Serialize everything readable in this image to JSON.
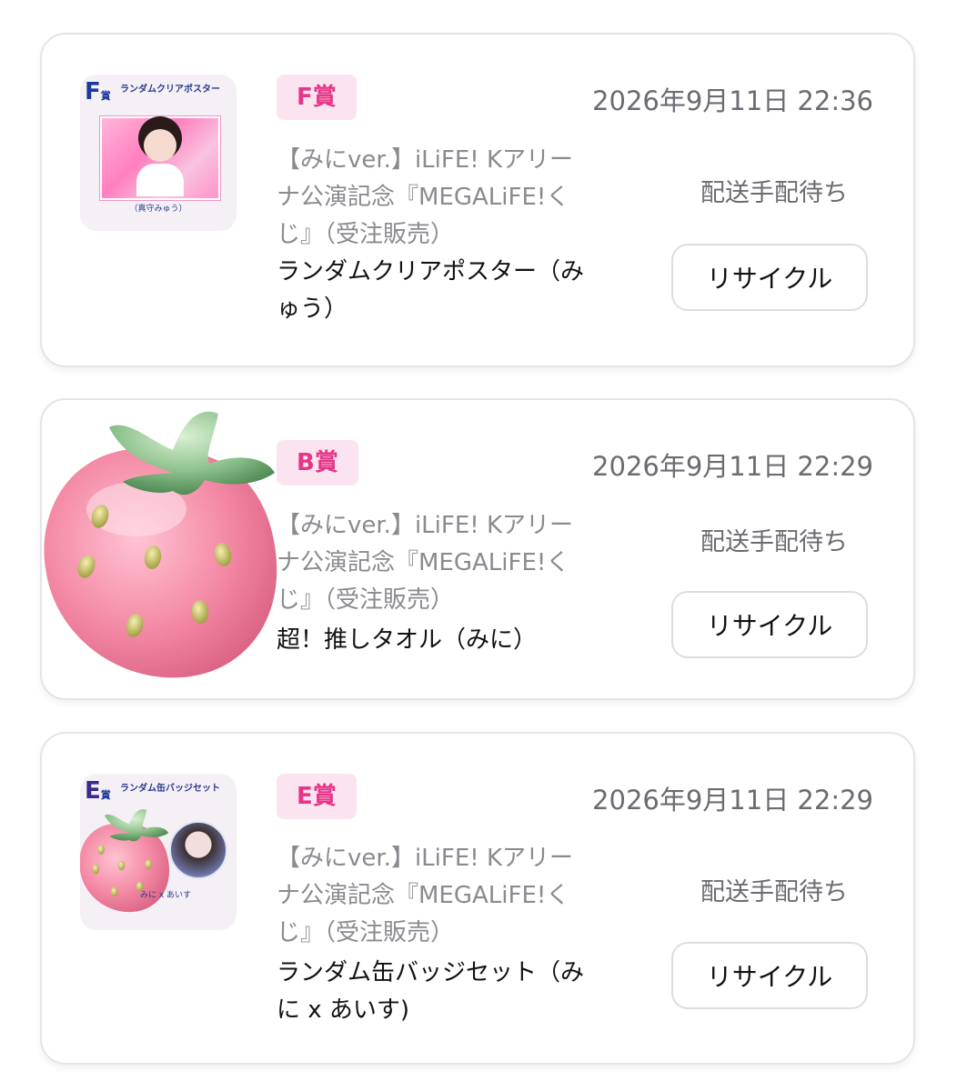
{
  "orders": [
    {
      "prize": "F賞",
      "timestamp": "2026年9月11日 22:36",
      "lottery_lines": [
        "【みにver.】iLiFE! Kアリー",
        "ナ公演記念『MEGALiFE!く",
        "じ』（受注販売）"
      ],
      "item_lines": [
        "ランダムクリアポスター（み",
        "ゅう）"
      ],
      "status": "配送手配待ち",
      "button": "リサイクル",
      "thumb": {
        "letter": "F",
        "letter_suffix": "賞",
        "title": "ランダムクリアポスター",
        "caption": "（真守みゅう）"
      }
    },
    {
      "prize": "B賞",
      "timestamp": "2026年9月11日 22:29",
      "lottery_lines": [
        "【みにver.】iLiFE! Kアリー",
        "ナ公演記念『MEGALiFE!く",
        "じ』（受注販売）"
      ],
      "item_lines": [
        "超！推しタオル（みに）"
      ],
      "status": "配送手配待ち",
      "button": "リサイクル"
    },
    {
      "prize": "E賞",
      "timestamp": "2026年9月11日 22:29",
      "lottery_lines": [
        "【みにver.】iLiFE! Kアリー",
        "ナ公演記念『MEGALiFE!く",
        "じ』（受注販売）"
      ],
      "item_lines": [
        "ランダム缶バッジセット（み",
        "に x あいす)"
      ],
      "status": "配送手配待ち",
      "button": "リサイクル",
      "thumb": {
        "letter": "E",
        "letter_suffix": "賞",
        "title": "ランダム缶バッジセット",
        "caption": "みに x あいす"
      }
    }
  ],
  "colors": {
    "prize_badge_bg": "#fbe4ef",
    "prize_badge_text": "#e5368a",
    "muted_text": "#6b6b72",
    "card_border": "#e4e4ea"
  }
}
